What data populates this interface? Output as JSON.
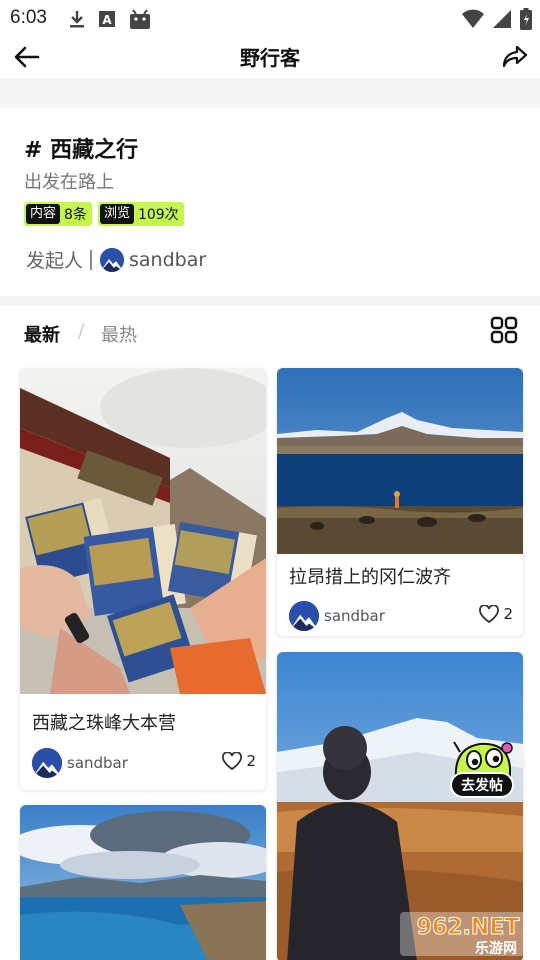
{
  "status_bar": {
    "time": "6:03",
    "left_icons": [
      "download-icon",
      "font-a-icon",
      "android-icon"
    ],
    "right_icons": [
      "wifi-icon",
      "signal-icon",
      "battery-icon"
    ]
  },
  "header": {
    "title": "野行客",
    "back_icon": "arrow-left-icon",
    "share_icon": "share-icon"
  },
  "topic": {
    "name": "# 西藏之行",
    "subtitle": "出发在路上",
    "stats": [
      {
        "key": "内容",
        "value": "8条"
      },
      {
        "key": "浏览",
        "value": "109次"
      }
    ],
    "initiator_label": "发起人",
    "initiator_name": "sandbar"
  },
  "tabs": {
    "latest": "最新",
    "separator": "/",
    "hot": "最热",
    "layout_icon": "grid-view-icon"
  },
  "feed": {
    "cards": [
      {
        "title": "西藏之珠峰大本营",
        "user": "sandbar",
        "likes": "2",
        "image": "tickets-at-everest-gate-photo"
      },
      {
        "title": "拉昂措上的冈仁波齐",
        "user": "sandbar",
        "likes": "2",
        "image": "lake-and-mountain-photo"
      },
      {
        "title": "",
        "user": "",
        "likes": "",
        "image": "blue-lake-clouds-photo"
      },
      {
        "title": "",
        "user": "",
        "likes": "",
        "image": "person-snow-mountain-photo"
      }
    ]
  },
  "post_button": {
    "label": "去发帖"
  },
  "watermark": {
    "text_top": "962.NET",
    "text_bottom": "乐游网"
  },
  "colors": {
    "accent": "#c5f74a",
    "background": "#f4f4f4",
    "text": "#111111"
  }
}
